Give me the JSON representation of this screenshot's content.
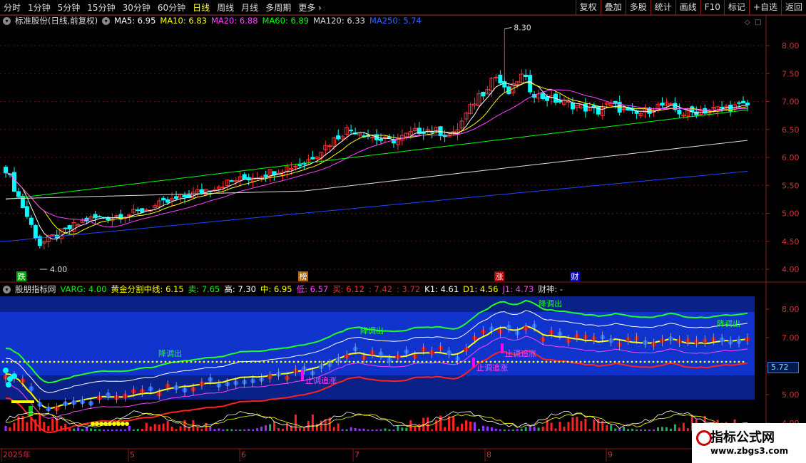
{
  "topbar": {
    "periods": [
      "分时",
      "1分钟",
      "5分钟",
      "15分钟",
      "30分钟",
      "60分钟",
      "日线",
      "周线",
      "月线",
      "多周期",
      "更多 ›"
    ],
    "active_period": "日线",
    "tools": [
      "复权",
      "叠加",
      "多股",
      "统计",
      "画线",
      "F10",
      "标记",
      "+自选",
      "返回"
    ]
  },
  "main_legend": {
    "title": "标准股份(日线,前复权)",
    "ma5": "MA5: 6.95",
    "ma10": "MA10: 6.83",
    "ma20": "MA20: 6.88",
    "ma60": "MA60: 6.89",
    "ma120": "MA120: 6.33",
    "ma250": "MA250: 5.74"
  },
  "sub_legend": {
    "title": "股朋指标网",
    "varg": "VARG: 4.00",
    "golden": "黄金分割中线: 6.15",
    "sell": "卖: 7.65",
    "high": "高: 7.30",
    "mid": "中: 6.95",
    "low": "低: 6.57",
    "buy": "买: 6.12",
    "v1": ": 7.42",
    "v2": ": 3.72",
    "k1": "K1: 4.61",
    "d1": "D1: 4.56",
    "j1": "J1: 4.73",
    "caishen": "财神: -"
  },
  "main_axis_labels": [
    "8.00",
    "7.50",
    "7.00",
    "6.50",
    "6.00",
    "5.50",
    "5.00",
    "4.50",
    "4.00"
  ],
  "sub_axis_labels": [
    "8.00",
    "7.00",
    "6.00",
    "5.00",
    "4.00"
  ],
  "sub_axis_highlight": "5.72",
  "annotations": {
    "high": "8.30",
    "low": "4.00",
    "tag_die": "跌",
    "tag_bang": "榜",
    "tag_zhang": "涨",
    "tag_cai": "财",
    "tiaochu": "降调出",
    "zhuizhang": "止调追涨"
  },
  "date_labels": [
    "2025年",
    "5",
    "6",
    "7",
    "8",
    "9"
  ],
  "watermark": {
    "title": "指标公式网",
    "url": "www.zbgs3.com"
  },
  "colors": {
    "up": "#ff3333",
    "down": "#00ffff",
    "ma5": "#ffffff",
    "ma10": "#ffff00",
    "ma20": "#ff44ff",
    "ma60": "#00ff00",
    "ma120": "#dddddd",
    "ma250": "#2244ff"
  }
}
